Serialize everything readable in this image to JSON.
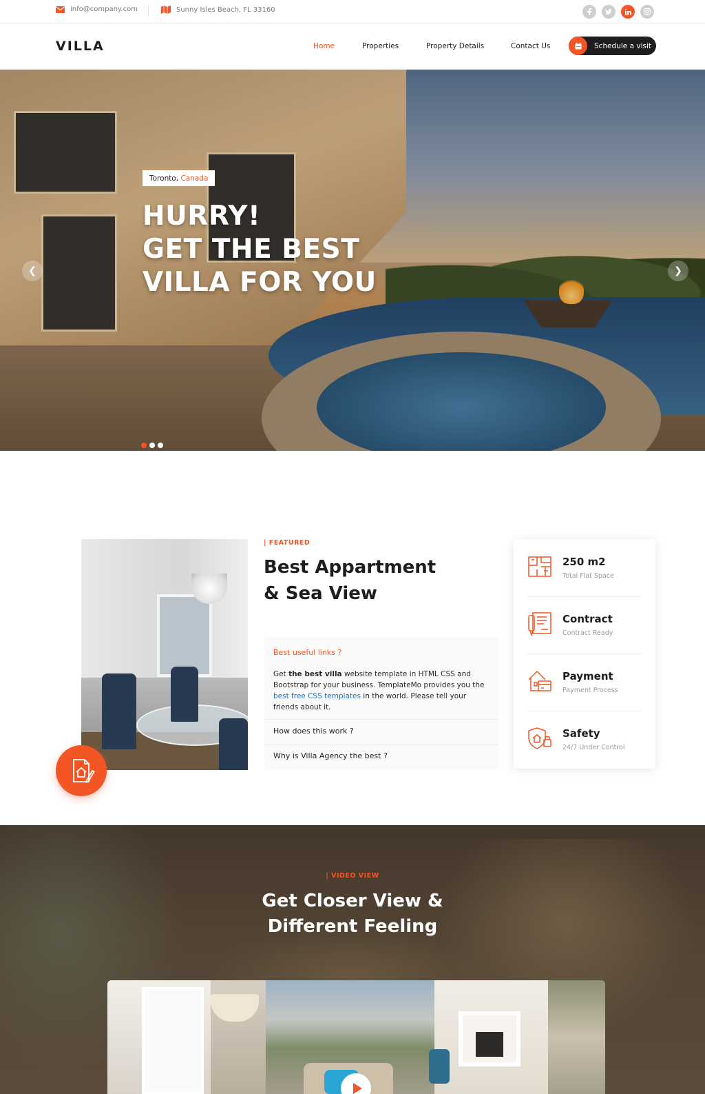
{
  "topbar": {
    "email": "info@company.com",
    "address": "Sunny Isles Beach, FL 33160",
    "social": [
      "facebook-icon",
      "twitter-icon",
      "linkedin-icon",
      "instagram-icon"
    ]
  },
  "nav": {
    "logo": "VILLA",
    "links": [
      "Home",
      "Properties",
      "Property Details",
      "Contact Us"
    ],
    "active": "Home",
    "cta": "Schedule a visit"
  },
  "hero": {
    "city": "Toronto,",
    "country": "Canada",
    "lines": [
      "HURRY!",
      "GET THE BEST",
      "VILLA FOR YOU"
    ],
    "slides": 3,
    "active_slide": 1
  },
  "featured": {
    "tag": "| Featured",
    "title_line1": "Best Appartment",
    "title_line2": "& Sea View",
    "accordion": {
      "q1": "Best useful links ?",
      "a1_pre": "Get ",
      "a1_bold": "the best villa",
      "a1_mid": " website template in HTML CSS and Bootstrap for your business. TemplateMo provides you the ",
      "a1_link": "best free CSS templates",
      "a1_post": " in the world. Please tell your friends about it.",
      "q2": "How does this work ?",
      "q3": "Why is Villa Agency the best ?"
    },
    "info": [
      {
        "value": "250 m2",
        "label": "Total Flat Space",
        "icon": "floor-plan-icon"
      },
      {
        "value": "Contract",
        "label": "Contract Ready",
        "icon": "contract-icon"
      },
      {
        "value": "Payment",
        "label": "Payment Process",
        "icon": "payment-house-icon"
      },
      {
        "value": "Safety",
        "label": "24/7 Under Control",
        "icon": "safety-shield-icon"
      }
    ]
  },
  "video": {
    "tag": "| Video View",
    "title_line1": "Get Closer View &",
    "title_line2": "Different Feeling"
  },
  "colors": {
    "accent": "#f35525",
    "dark": "#1e1e1e",
    "link": "#1e6fb8"
  }
}
